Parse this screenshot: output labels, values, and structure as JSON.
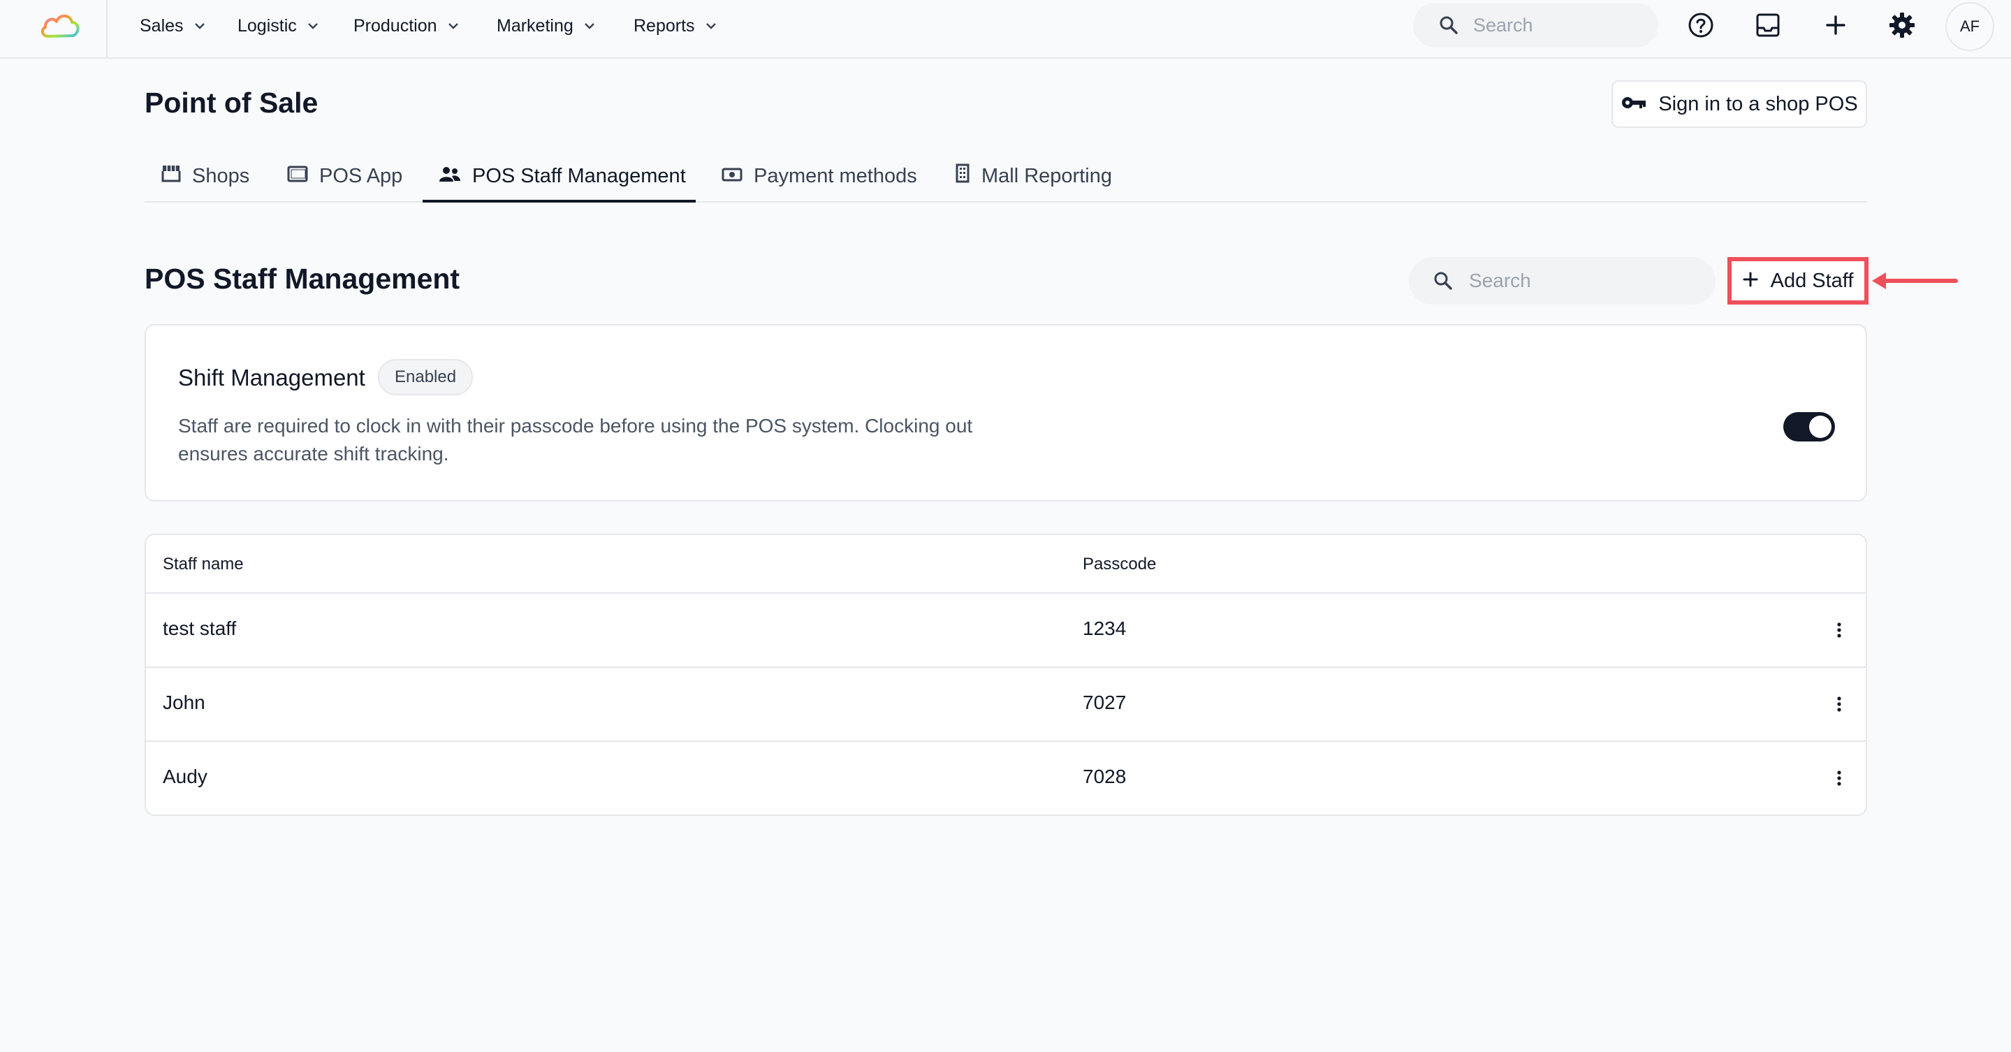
{
  "topnav": {
    "menu": [
      {
        "label": "Sales"
      },
      {
        "label": "Logistic"
      },
      {
        "label": "Production"
      },
      {
        "label": "Marketing"
      },
      {
        "label": "Reports"
      }
    ],
    "search_placeholder": "Search",
    "avatar_initials": "AF",
    "icons": [
      "cloud-logo",
      "help-icon",
      "inbox-icon",
      "plus-icon",
      "gear-icon"
    ]
  },
  "page": {
    "title": "Point of Sale",
    "signin_button": "Sign in to a shop POS",
    "tabs": [
      {
        "label": "Shops",
        "icon": "store-icon"
      },
      {
        "label": "POS App",
        "icon": "tablet-icon"
      },
      {
        "label": "POS Staff Management",
        "icon": "people-icon",
        "active": true
      },
      {
        "label": "Payment methods",
        "icon": "cash-icon"
      },
      {
        "label": "Mall Reporting",
        "icon": "building-icon"
      }
    ]
  },
  "section": {
    "title": "POS Staff Management",
    "search_placeholder": "Search",
    "add_button": "Add Staff",
    "highlight_color": "#ef4f5a"
  },
  "shift": {
    "title": "Shift Management",
    "badge": "Enabled",
    "description": "Staff are required to clock in with their passcode before using the POS system. Clocking out ensures accurate shift tracking.",
    "toggle_on": true
  },
  "table": {
    "headers": [
      "Staff name",
      "Passcode"
    ],
    "rows": [
      {
        "name": "test staff",
        "passcode": "1234"
      },
      {
        "name": "John",
        "passcode": "7027"
      },
      {
        "name": "Audy",
        "passcode": "7028"
      }
    ]
  },
  "colors": {
    "primary": "#111827",
    "background": "#f9fafb",
    "muted": "#4b5563"
  }
}
